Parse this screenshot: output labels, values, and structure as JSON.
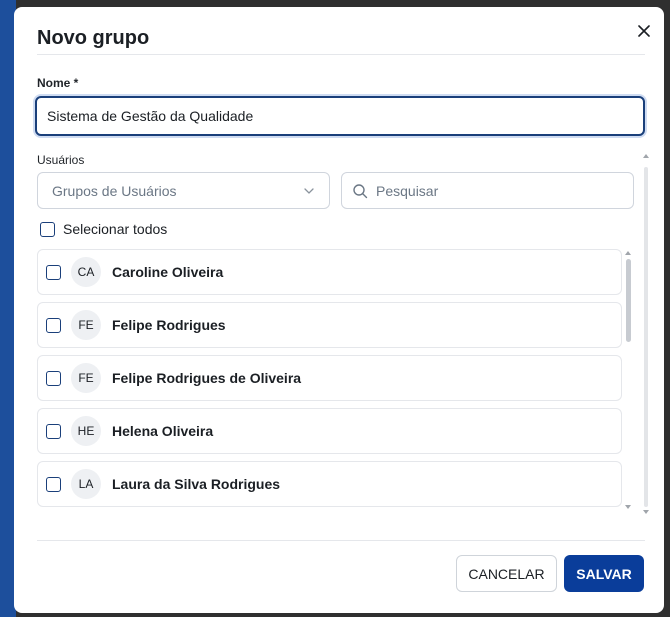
{
  "modal": {
    "title": "Novo grupo",
    "close_icon": "close-icon"
  },
  "name_field": {
    "label": "Nome *",
    "value": "Sistema de Gestão da Qualidade"
  },
  "users_section": {
    "label": "Usuários",
    "group_select": {
      "placeholder": "Grupos de Usuários",
      "icon": "chevron-down-icon"
    },
    "search": {
      "placeholder": "Pesquisar",
      "icon": "search-icon"
    },
    "select_all_label": "Selecionar todos",
    "users": [
      {
        "initials": "CA",
        "name": "Caroline Oliveira"
      },
      {
        "initials": "FE",
        "name": "Felipe Rodrigues"
      },
      {
        "initials": "FE",
        "name": "Felipe Rodrigues de Oliveira"
      },
      {
        "initials": "HE",
        "name": "Helena Oliveira"
      },
      {
        "initials": "LA",
        "name": "Laura da Silva Rodrigues"
      }
    ]
  },
  "footer": {
    "cancel_label": "CANCELAR",
    "save_label": "SALVAR"
  },
  "colors": {
    "primary": "#0a3d9a",
    "focus_border": "#1a3f7a",
    "text": "#1b1f24",
    "muted": "#6b7785",
    "border": "#d0d5dd"
  }
}
